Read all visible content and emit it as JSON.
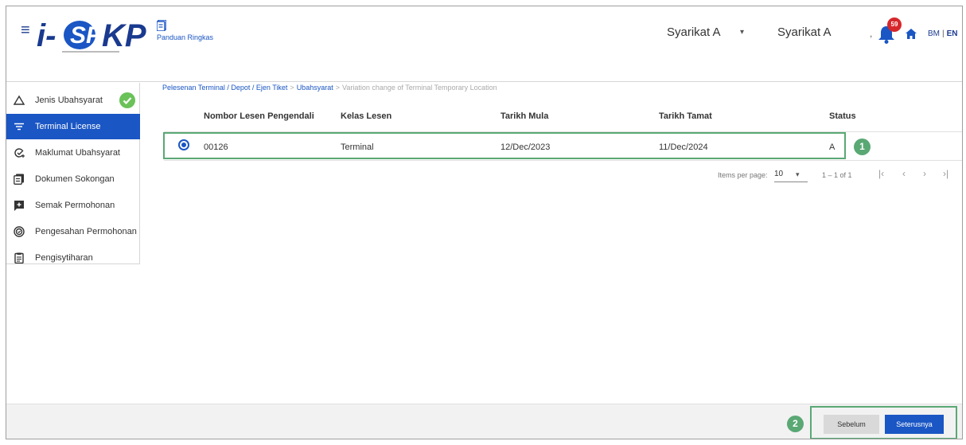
{
  "header": {
    "menu_icon": "hamburger-icon",
    "logo_text": "i-SPKP",
    "guide_label": "Panduan Ringkas",
    "company_primary": "Syarikat A",
    "company_secondary": "Syarikat A",
    "comma": ",",
    "notification_count": "59",
    "lang_bm": "BM",
    "lang_sep": "|",
    "lang_en": "EN"
  },
  "sidebar": {
    "items": [
      {
        "label": "Jenis Ubahsyarat",
        "icon": "triangle-icon",
        "completed": true
      },
      {
        "label": "Terminal License",
        "icon": "filter-icon",
        "active": true
      },
      {
        "label": "Maklumat Ubahsyarat",
        "icon": "edit-check-icon"
      },
      {
        "label": "Dokumen Sokongan",
        "icon": "documents-icon"
      },
      {
        "label": "Semak Permohonan",
        "icon": "review-icon"
      },
      {
        "label": "Pengesahan Permohonan",
        "icon": "verify-icon"
      },
      {
        "label": "Pengisytiharan",
        "icon": "clipboard-icon"
      }
    ]
  },
  "breadcrumb": {
    "items": [
      "Pelesenan Terminal / Depot / Ejen Tiket",
      "Ubahsyarat"
    ],
    "current": "Variation change of Terminal Temporary Location",
    "sep": ">"
  },
  "table": {
    "headers": [
      "Nombor Lesen Pengendali",
      "Kelas Lesen",
      "Tarikh Mula",
      "Tarikh Tamat",
      "Status"
    ],
    "rows": [
      {
        "lesen": "00126",
        "kelas": "Terminal",
        "mula": "12/Dec/2023",
        "tamat": "11/Dec/2024",
        "status": "A",
        "selected": true
      }
    ]
  },
  "pagination": {
    "items_per_page_label": "Items per page:",
    "items_per_page": "10",
    "range": "1 – 1 of 1"
  },
  "annotations": {
    "one": "1",
    "two": "2"
  },
  "footer": {
    "prev_label": "Sebelum",
    "next_label": "Seterusnya"
  },
  "colors": {
    "primary": "#1a56c4",
    "success": "#6ac259",
    "highlight": "#5aa874",
    "badge": "#d6272b"
  }
}
